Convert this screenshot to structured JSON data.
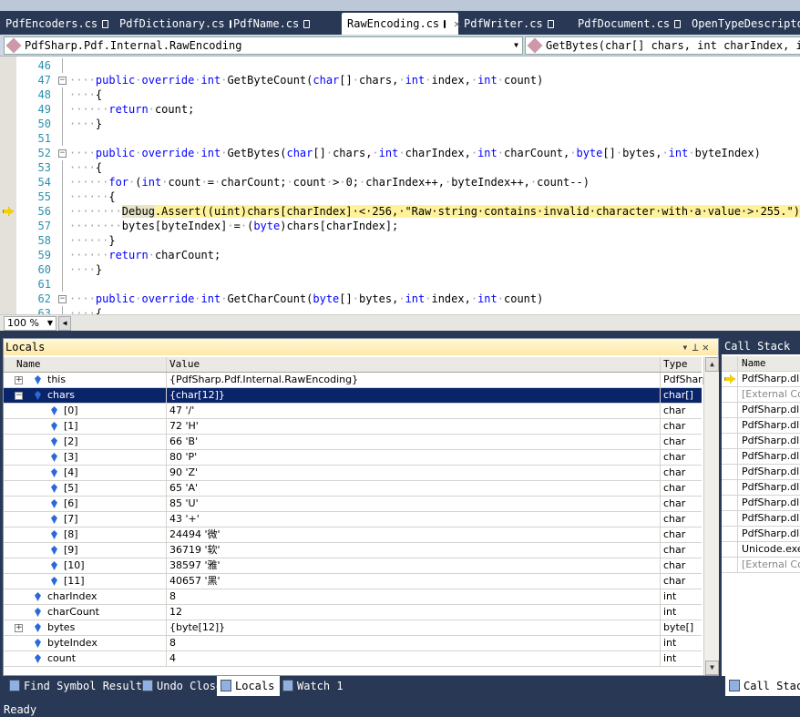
{
  "tabs": [
    {
      "label": "PdfEncoders.cs"
    },
    {
      "label": "PdfDictionary.cs"
    },
    {
      "label": "PdfName.cs"
    },
    {
      "label": "RawEncoding.cs",
      "active": true
    },
    {
      "label": "PdfWriter.cs"
    },
    {
      "label": "PdfDocument.cs"
    },
    {
      "label": "OpenTypeDescriptor.cs"
    }
  ],
  "navbar": {
    "type_selector": "PdfSharp.Pdf.Internal.RawEncoding",
    "member_selector": "GetBytes(char[] chars, int charIndex, int charCount, byte[] bytes, int byteIndex)"
  },
  "editor": {
    "zoom": "100 %",
    "current_line": 56,
    "lines": [
      {
        "n": "46",
        "segs": []
      },
      {
        "n": "47",
        "fold": "-",
        "segs": [
          [
            "d",
            "····"
          ],
          [
            "k",
            "public"
          ],
          [
            "d",
            "·"
          ],
          [
            "k",
            "override"
          ],
          [
            "d",
            "·"
          ],
          [
            "k",
            "int"
          ],
          [
            "d",
            "·"
          ],
          [
            "",
            "GetByteCount("
          ],
          [
            "k",
            "char"
          ],
          [
            "",
            "[]"
          ],
          [
            "d",
            "·"
          ],
          [
            "",
            "chars,"
          ],
          [
            "d",
            "·"
          ],
          [
            "k",
            "int"
          ],
          [
            "d",
            "·"
          ],
          [
            "",
            "index,"
          ],
          [
            "d",
            "·"
          ],
          [
            "k",
            "int"
          ],
          [
            "d",
            "·"
          ],
          [
            "",
            "count)"
          ]
        ]
      },
      {
        "n": "48",
        "segs": [
          [
            "d",
            "····"
          ],
          [
            "",
            "{"
          ]
        ]
      },
      {
        "n": "49",
        "segs": [
          [
            "d",
            "······"
          ],
          [
            "k",
            "return"
          ],
          [
            "d",
            "·"
          ],
          [
            "",
            "count;"
          ]
        ]
      },
      {
        "n": "50",
        "segs": [
          [
            "d",
            "····"
          ],
          [
            "",
            "}"
          ]
        ]
      },
      {
        "n": "51",
        "segs": []
      },
      {
        "n": "52",
        "fold": "-",
        "segs": [
          [
            "d",
            "····"
          ],
          [
            "k",
            "public"
          ],
          [
            "d",
            "·"
          ],
          [
            "k",
            "override"
          ],
          [
            "d",
            "·"
          ],
          [
            "k",
            "int"
          ],
          [
            "d",
            "·"
          ],
          [
            "",
            "GetBytes("
          ],
          [
            "k",
            "char"
          ],
          [
            "",
            "[]"
          ],
          [
            "d",
            "·"
          ],
          [
            "",
            "chars,"
          ],
          [
            "d",
            "·"
          ],
          [
            "k",
            "int"
          ],
          [
            "d",
            "·"
          ],
          [
            "",
            "charIndex,"
          ],
          [
            "d",
            "·"
          ],
          [
            "k",
            "int"
          ],
          [
            "d",
            "·"
          ],
          [
            "",
            "charCount,"
          ],
          [
            "d",
            "·"
          ],
          [
            "k",
            "byte"
          ],
          [
            "",
            "[]"
          ],
          [
            "d",
            "·"
          ],
          [
            "",
            "bytes,"
          ],
          [
            "d",
            "·"
          ],
          [
            "k",
            "int"
          ],
          [
            "d",
            "·"
          ],
          [
            "",
            "byteIndex)"
          ]
        ]
      },
      {
        "n": "53",
        "segs": [
          [
            "d",
            "····"
          ],
          [
            "",
            "{"
          ]
        ]
      },
      {
        "n": "54",
        "segs": [
          [
            "d",
            "······"
          ],
          [
            "k",
            "for"
          ],
          [
            "d",
            "·"
          ],
          [
            "",
            "("
          ],
          [
            "k",
            "int"
          ],
          [
            "d",
            "·"
          ],
          [
            "",
            "count"
          ],
          [
            "d",
            "·"
          ],
          [
            "",
            "="
          ],
          [
            "d",
            "·"
          ],
          [
            "",
            "charCount;"
          ],
          [
            "d",
            "·"
          ],
          [
            "",
            "count"
          ],
          [
            "d",
            "·"
          ],
          [
            "",
            ">"
          ],
          [
            "d",
            "·"
          ],
          [
            "",
            "0;"
          ],
          [
            "d",
            "·"
          ],
          [
            "",
            "charIndex++,"
          ],
          [
            "d",
            "·"
          ],
          [
            "",
            "byteIndex++,"
          ],
          [
            "d",
            "·"
          ],
          [
            "",
            "count--)"
          ]
        ]
      },
      {
        "n": "55",
        "segs": [
          [
            "d",
            "······"
          ],
          [
            "",
            "{"
          ]
        ]
      },
      {
        "n": "56",
        "current": true,
        "segs": [
          [
            "d",
            "········"
          ],
          [
            "hl cur",
            "Debug"
          ],
          [
            "hl",
            ".Assert((uint)chars[charIndex]·<·256,·\"Raw·string·contains·invalid·character·with·a·value·>·255.\");"
          ]
        ]
      },
      {
        "n": "57",
        "segs": [
          [
            "d",
            "········"
          ],
          [
            "",
            "bytes[byteIndex]"
          ],
          [
            "d",
            "·"
          ],
          [
            "",
            "="
          ],
          [
            "d",
            "·"
          ],
          [
            "",
            "("
          ],
          [
            "k",
            "byte"
          ],
          [
            "",
            ")chars[charIndex];"
          ]
        ]
      },
      {
        "n": "58",
        "segs": [
          [
            "d",
            "······"
          ],
          [
            "",
            "}"
          ]
        ]
      },
      {
        "n": "59",
        "segs": [
          [
            "d",
            "······"
          ],
          [
            "k",
            "return"
          ],
          [
            "d",
            "·"
          ],
          [
            "",
            "charCount;"
          ]
        ]
      },
      {
        "n": "60",
        "segs": [
          [
            "d",
            "····"
          ],
          [
            "",
            "}"
          ]
        ]
      },
      {
        "n": "61",
        "segs": []
      },
      {
        "n": "62",
        "fold": "-",
        "segs": [
          [
            "d",
            "····"
          ],
          [
            "k",
            "public"
          ],
          [
            "d",
            "·"
          ],
          [
            "k",
            "override"
          ],
          [
            "d",
            "·"
          ],
          [
            "k",
            "int"
          ],
          [
            "d",
            "·"
          ],
          [
            "",
            "GetCharCount("
          ],
          [
            "k",
            "byte"
          ],
          [
            "",
            "[]"
          ],
          [
            "d",
            "·"
          ],
          [
            "",
            "bytes,"
          ],
          [
            "d",
            "·"
          ],
          [
            "k",
            "int"
          ],
          [
            "d",
            "·"
          ],
          [
            "",
            "index,"
          ],
          [
            "d",
            "·"
          ],
          [
            "k",
            "int"
          ],
          [
            "d",
            "·"
          ],
          [
            "",
            "count)"
          ]
        ]
      },
      {
        "n": "63",
        "segs": [
          [
            "d",
            "····"
          ],
          [
            "",
            "{"
          ]
        ]
      }
    ]
  },
  "locals": {
    "title": "Locals",
    "columns": {
      "name": "Name",
      "value": "Value",
      "type": "Type"
    },
    "rows": [
      {
        "name": "this",
        "value": "{PdfSharp.Pdf.Internal.RawEncoding}",
        "type": "PdfSharp.Pdf.Internal.RawEncoding",
        "level": 0,
        "expander": "+"
      },
      {
        "name": "chars",
        "value": "{char[12]}",
        "type": "char[]",
        "level": 0,
        "expander": "-",
        "selected": true
      },
      {
        "name": "[0]",
        "value": "47 '/'",
        "type": "char",
        "level": 1
      },
      {
        "name": "[1]",
        "value": "72 'H'",
        "type": "char",
        "level": 1
      },
      {
        "name": "[2]",
        "value": "66 'B'",
        "type": "char",
        "level": 1
      },
      {
        "name": "[3]",
        "value": "80 'P'",
        "type": "char",
        "level": 1
      },
      {
        "name": "[4]",
        "value": "90 'Z'",
        "type": "char",
        "level": 1
      },
      {
        "name": "[5]",
        "value": "65 'A'",
        "type": "char",
        "level": 1
      },
      {
        "name": "[6]",
        "value": "85 'U'",
        "type": "char",
        "level": 1
      },
      {
        "name": "[7]",
        "value": "43 '+'",
        "type": "char",
        "level": 1
      },
      {
        "name": "[8]",
        "value": "24494 '微'",
        "type": "char",
        "level": 1
      },
      {
        "name": "[9]",
        "value": "36719 '软'",
        "type": "char",
        "level": 1
      },
      {
        "name": "[10]",
        "value": "38597 '雅'",
        "type": "char",
        "level": 1
      },
      {
        "name": "[11]",
        "value": "40657 '黑'",
        "type": "char",
        "level": 1
      },
      {
        "name": "charIndex",
        "value": "8",
        "type": "int",
        "level": 0
      },
      {
        "name": "charCount",
        "value": "12",
        "type": "int",
        "level": 0
      },
      {
        "name": "bytes",
        "value": "{byte[12]}",
        "type": "byte[]",
        "level": 0,
        "expander": "+"
      },
      {
        "name": "byteIndex",
        "value": "8",
        "type": "int",
        "level": 0
      },
      {
        "name": "count",
        "value": "4",
        "type": "int",
        "level": 0
      }
    ]
  },
  "callstack": {
    "title": "Call Stack",
    "column": "Name",
    "rows": [
      {
        "text": "PdfSharp.dll",
        "current": true
      },
      {
        "text": "[External Code]",
        "external": true
      },
      {
        "text": "PdfSharp.dll"
      },
      {
        "text": "PdfSharp.dll"
      },
      {
        "text": "PdfSharp.dll"
      },
      {
        "text": "PdfSharp.dll"
      },
      {
        "text": "PdfSharp.dll"
      },
      {
        "text": "PdfSharp.dll"
      },
      {
        "text": "PdfSharp.dll"
      },
      {
        "text": "PdfSharp.dll"
      },
      {
        "text": "PdfSharp.dll"
      },
      {
        "text": "Unicode.exe"
      },
      {
        "text": "[External Code]",
        "external": true
      }
    ]
  },
  "bottom_tabs": [
    {
      "label": "Find Symbol Results"
    },
    {
      "label": "Undo Close"
    },
    {
      "label": "Locals",
      "active": true
    },
    {
      "label": "Watch 1"
    }
  ],
  "callstack_tab": "Call Stack",
  "status": "Ready"
}
